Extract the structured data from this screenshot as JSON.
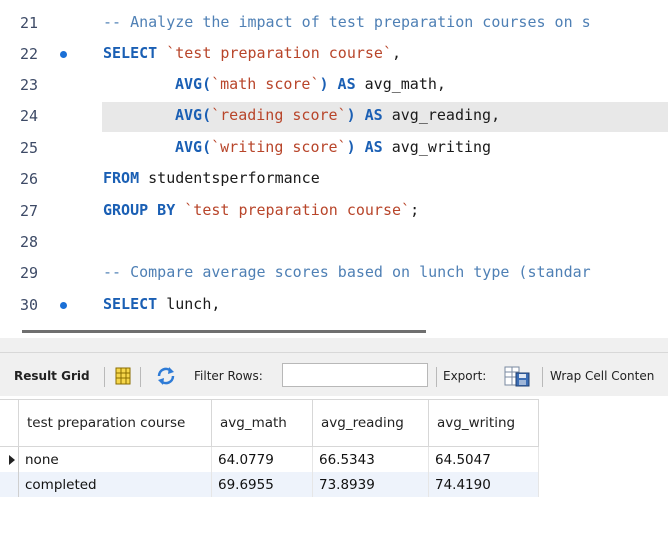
{
  "editor": {
    "lines": [
      {
        "num": "21",
        "text": "-- Analyze the impact of test preparation courses on s"
      },
      {
        "num": "22",
        "kw1": "SELECT",
        "str1": "`test preparation course`",
        "rest": ","
      },
      {
        "num": "23",
        "kw1": "AVG(",
        "str1": "`math score`",
        "kw2": ") AS",
        "id1": "avg_math,"
      },
      {
        "num": "24",
        "kw1": "AVG(",
        "str1": "`reading score`",
        "kw2": ") AS",
        "id1": "avg_reading,"
      },
      {
        "num": "25",
        "kw1": "AVG(",
        "str1": "`writing score`",
        "kw2": ") AS",
        "id1": "avg_writing"
      },
      {
        "num": "26",
        "kw1": "FROM",
        "id1": "studentsperformance"
      },
      {
        "num": "27",
        "kw1": "GROUP BY",
        "str1": "`test preparation course`",
        "rest": ";"
      },
      {
        "num": "28"
      },
      {
        "num": "29",
        "text": "-- Compare average scores based on lunch type (standar"
      },
      {
        "num": "30",
        "kw1": "SELECT",
        "id1": "lunch,"
      }
    ]
  },
  "toolbar": {
    "result_grid": "Result Grid",
    "filter_rows": "Filter Rows:",
    "filter_value": "",
    "export": "Export:",
    "wrap": "Wrap Cell Conten"
  },
  "grid": {
    "columns": [
      "test preparation course",
      "avg_math",
      "avg_reading",
      "avg_writing"
    ],
    "rows": [
      [
        "none",
        "64.0779",
        "66.5343",
        "64.5047"
      ],
      [
        "completed",
        "69.6955",
        "73.8939",
        "74.4190"
      ]
    ]
  },
  "colors": {
    "keyword": "#1a5fb4",
    "comment": "#4f80b5",
    "string": "#b8452a",
    "breakpoint": "#1a6fd6",
    "current_line": "#e8e8e8",
    "alt_row": "#eef3fb"
  },
  "icons": [
    "breakpoint-dot-icon",
    "grid-icon",
    "refresh-icon",
    "export-icon",
    "row-pointer-icon"
  ]
}
